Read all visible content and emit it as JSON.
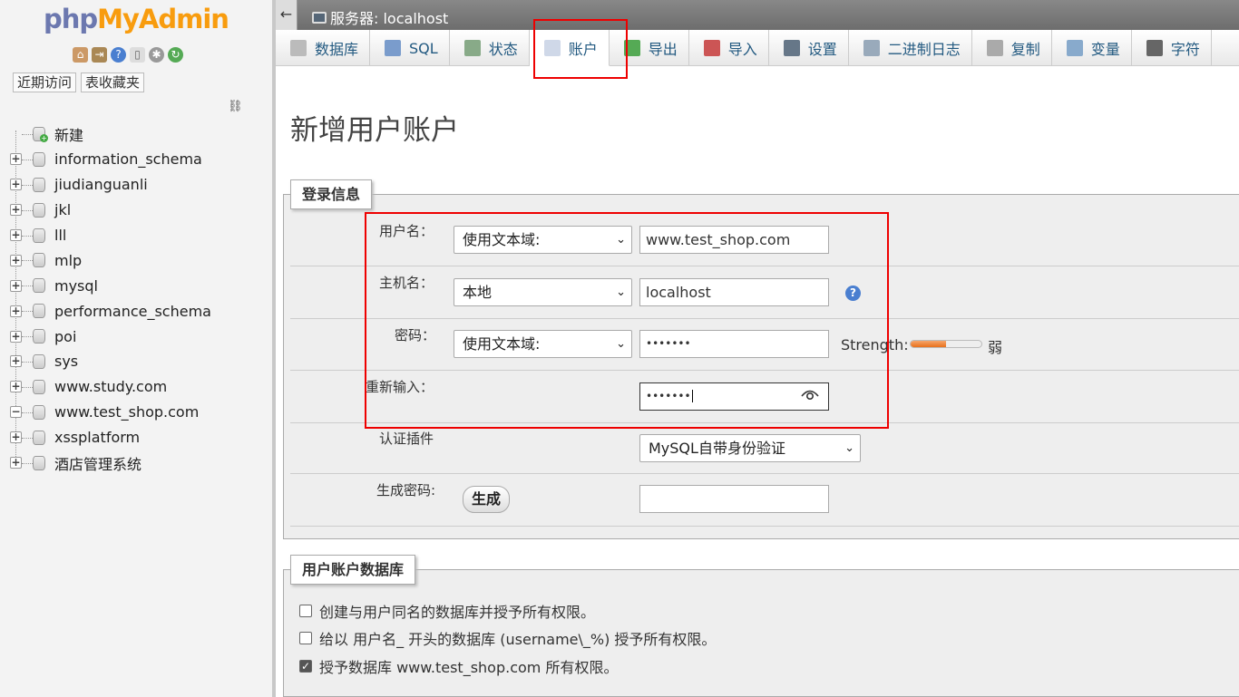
{
  "sidebar": {
    "logo_php": "php",
    "logo_myadmin": "MyAdmin",
    "nav_tabs": [
      "近期访问",
      "表收藏夹"
    ],
    "new_label": "新建",
    "databases": [
      "information_schema",
      "jiudianguanli",
      "jkl",
      "lll",
      "mlp",
      "mysql",
      "performance_schema",
      "poi",
      "sys",
      "www.study.com",
      "www.test_shop.com",
      "xssplatform",
      "酒店管理系统"
    ]
  },
  "topbar": {
    "back": "←",
    "server_label": "服务器: localhost"
  },
  "menu": {
    "tabs": [
      {
        "label": "数据库",
        "icon": "database-icon"
      },
      {
        "label": "SQL",
        "icon": "sql-icon"
      },
      {
        "label": "状态",
        "icon": "status-icon"
      },
      {
        "label": "账户",
        "icon": "accounts-icon"
      },
      {
        "label": "导出",
        "icon": "export-icon"
      },
      {
        "label": "导入",
        "icon": "import-icon"
      },
      {
        "label": "设置",
        "icon": "settings-icon"
      },
      {
        "label": "二进制日志",
        "icon": "binlog-icon"
      },
      {
        "label": "复制",
        "icon": "replication-icon"
      },
      {
        "label": "变量",
        "icon": "variables-icon"
      },
      {
        "label": "字符",
        "icon": "charset-icon"
      }
    ],
    "active": "账户"
  },
  "main": {
    "title": "新增用户账户",
    "login_legend": "登录信息",
    "username_label": "用户名：",
    "username_mode": "使用文本域:",
    "username_value": "www.test_shop.com",
    "host_label": "主机名：",
    "host_mode": "本地",
    "host_value": "localhost",
    "password_label": "密码：",
    "password_mode": "使用文本域:",
    "password_value": "•••••••",
    "strength_label": "Strength:",
    "strength_value": "弱",
    "strength_level": 0.5,
    "retype_label": "重新输入：",
    "retype_value": "•••••••",
    "auth_label": "认证插件",
    "auth_value": "MySQL自带身份验证",
    "gen_label": "生成密码:",
    "gen_button": "生成",
    "db_legend": "用户账户数据库",
    "checkboxes": [
      {
        "label": "创建与用户同名的数据库并授予所有权限。",
        "checked": false
      },
      {
        "label": "给以 用户名_ 开头的数据库 (username\\_%) 授予所有权限。",
        "checked": false
      },
      {
        "label": "授予数据库 www.test_shop.com 所有权限。",
        "checked": true
      }
    ]
  }
}
